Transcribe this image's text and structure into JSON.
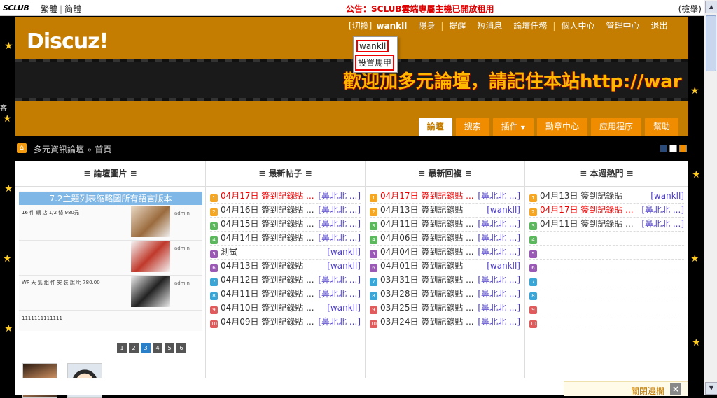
{
  "topbar": {
    "logo_main": "SCLUB",
    "lang_trad": "繁體",
    "lang_simp": "简體",
    "announce": "公告：SCLUB雲端專屬主機已開放租用",
    "report": "(檢舉)"
  },
  "header": {
    "logo": "Discuz!",
    "switch": "[切換]",
    "username": "wankll",
    "menu": [
      "隱身",
      "提醒",
      "短消息",
      "論壇任務",
      "個人中心",
      "管理中心",
      "退出"
    ]
  },
  "dropdown": {
    "user": "wankll",
    "alias": "設置馬甲"
  },
  "marquee": "歡迎加多元論壇，請記住本站http://war",
  "nav": {
    "tabs": [
      "論壇",
      "搜索",
      "插件",
      "勳章中心",
      "应用程序",
      "幫助"
    ]
  },
  "breadcrumb": {
    "forum": "多元資訊論壇",
    "arrow": "»",
    "page": "首頁"
  },
  "colors": {
    "header_bg": "#c47d00",
    "tab_bg": "#f08c00",
    "link_blue": "#4b3cc6",
    "red": "#e00000"
  },
  "columns": {
    "pics": {
      "title": "≡ 論壇圖片 ≡",
      "caption": "7.2主題列表縮略圖所有語言版本",
      "slides": [
        {
          "text": "16 件 網 店 1/2 條 980元",
          "meta": "admin"
        },
        {
          "text": "",
          "meta": "admin"
        },
        {
          "text": "WP 天 氣 組 件  安 裝 說 明 780.00",
          "meta": "admin"
        }
      ],
      "slide_num": "1111111111111",
      "pages": [
        "1",
        "2",
        "3",
        "4",
        "5",
        "6"
      ]
    },
    "posts": {
      "title": "≡ 最新帖子 ≡",
      "rows": [
        {
          "n": "1",
          "t": "04月17日 簽到記錄貼 ...",
          "a": "[鼻北北 ...]",
          "red": true
        },
        {
          "n": "2",
          "t": "04月16日 簽到記錄貼 ...",
          "a": "[鼻北北 ...]",
          "red": false
        },
        {
          "n": "3",
          "t": "04月15日 簽到記錄貼 ...",
          "a": "[鼻北北 ...]",
          "red": false
        },
        {
          "n": "4",
          "t": "04月14日 簽到記錄貼 ...",
          "a": "[鼻北北 ...]",
          "red": false
        },
        {
          "n": "5",
          "t": "測試",
          "a": "[wankll]",
          "red": false
        },
        {
          "n": "6",
          "t": "04月13日 簽到記錄貼",
          "a": "[wankll]",
          "red": false
        },
        {
          "n": "7",
          "t": "04月12日 簽到記錄貼 ...",
          "a": "[鼻北北 ...]",
          "red": false
        },
        {
          "n": "8",
          "t": "04月11日 簽到記錄貼 ...",
          "a": "[鼻北北 ...]",
          "red": false
        },
        {
          "n": "9",
          "t": "04月10日 簽到記錄貼 ...",
          "a": "[wankll]",
          "red": false
        },
        {
          "n": "10",
          "t": "04月09日 簽到記錄貼 ...",
          "a": "[鼻北北 ...]",
          "red": false
        }
      ]
    },
    "replies": {
      "title": "≡ 最新回複 ≡",
      "rows": [
        {
          "n": "1",
          "t": "04月17日 簽到記錄貼 ...",
          "a": "[鼻北北 ...]",
          "red": true
        },
        {
          "n": "2",
          "t": "04月13日 簽到記錄貼",
          "a": "[wankll]",
          "red": false
        },
        {
          "n": "3",
          "t": "04月11日 簽到記錄貼 ...",
          "a": "[鼻北北 ...]",
          "red": false
        },
        {
          "n": "4",
          "t": "04月06日 簽到記錄貼 ...",
          "a": "[鼻北北 ...]",
          "red": false
        },
        {
          "n": "5",
          "t": "04月04日 簽到記錄貼 ...",
          "a": "[鼻北北 ...]",
          "red": false
        },
        {
          "n": "6",
          "t": "04月01日 簽到記錄貼",
          "a": "[wankll]",
          "red": false
        },
        {
          "n": "7",
          "t": "03月31日 簽到記錄貼 ...",
          "a": "[鼻北北 ...]",
          "red": false
        },
        {
          "n": "8",
          "t": "03月28日 簽到記錄貼 ...",
          "a": "[鼻北北 ...]",
          "red": false
        },
        {
          "n": "9",
          "t": "03月25日 簽到記錄貼 ...",
          "a": "[鼻北北 ...]",
          "red": false
        },
        {
          "n": "10",
          "t": "03月24日 簽到記錄貼 ...",
          "a": "[鼻北北 ...]",
          "red": false
        }
      ]
    },
    "hot": {
      "title": "≡ 本週熱門 ≡",
      "rows": [
        {
          "n": "1",
          "t": "04月13日 簽到記錄貼",
          "a": "[wankll]",
          "red": false
        },
        {
          "n": "2",
          "t": "04月17日 簽到記錄貼 ...",
          "a": "[鼻北北 ...]",
          "red": true
        },
        {
          "n": "3",
          "t": "04月11日 簽到記錄貼 ...",
          "a": "[鼻北北 ...]",
          "red": false
        },
        {
          "n": "4",
          "t": "",
          "a": "",
          "red": false
        },
        {
          "n": "5",
          "t": "",
          "a": "",
          "red": false
        },
        {
          "n": "6",
          "t": "",
          "a": "",
          "red": false
        },
        {
          "n": "7",
          "t": "",
          "a": "",
          "red": false
        },
        {
          "n": "8",
          "t": "",
          "a": "",
          "red": false
        },
        {
          "n": "9",
          "t": "",
          "a": "",
          "red": false
        },
        {
          "n": "10",
          "t": "",
          "a": "",
          "red": false
        }
      ]
    }
  },
  "bottom": {
    "close_text": "關閉邊欄",
    "close_x": "×"
  },
  "side_char": "客"
}
